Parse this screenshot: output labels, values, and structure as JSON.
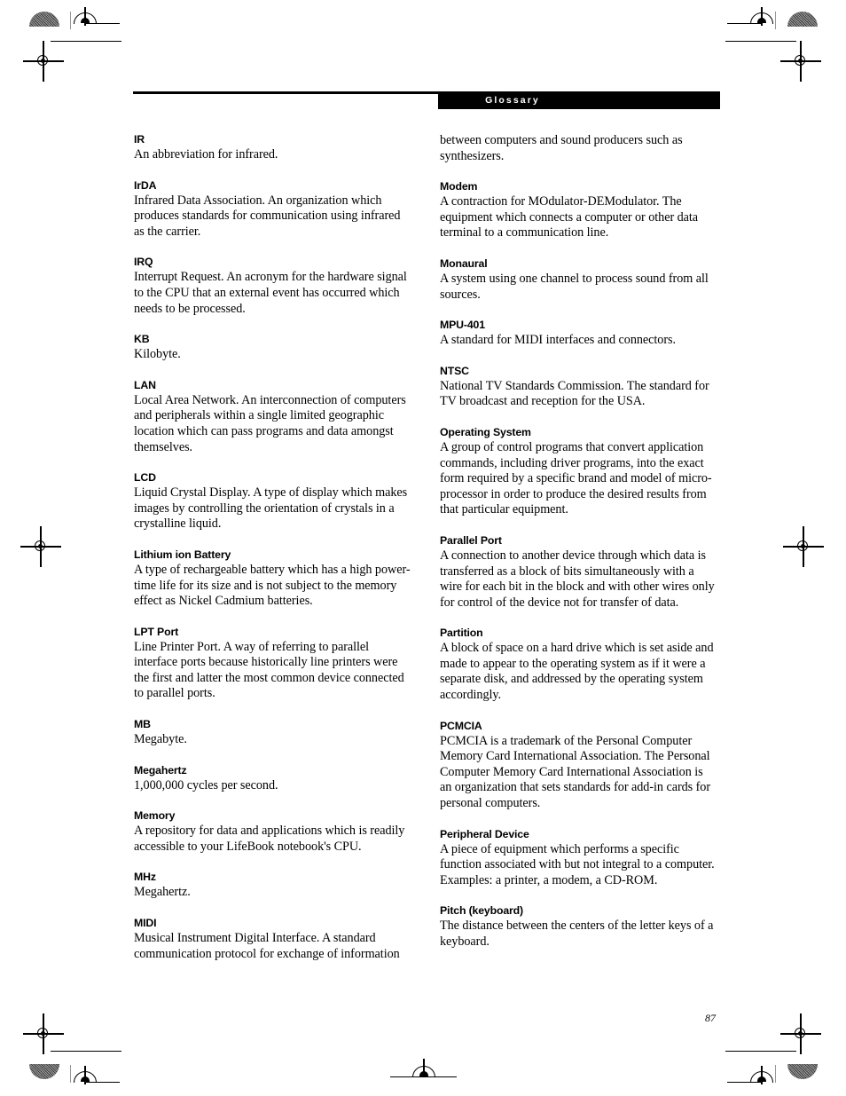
{
  "header": {
    "section_title": "Glossary"
  },
  "footer": {
    "page_number": "87"
  },
  "columns": {
    "left": [
      {
        "term": "IR",
        "definition": "An abbreviation for infrared."
      },
      {
        "term": "IrDA",
        "definition": "Infrared Data Association. An organization which produces standards for communication using infrared as the carrier."
      },
      {
        "term": "IRQ",
        "definition": "Interrupt Request. An acronym for the hardware signal to the CPU that an external event has occurred which needs to be processed."
      },
      {
        "term": "KB",
        "definition": "Kilobyte."
      },
      {
        "term": "LAN",
        "definition": "Local Area Network. An interconnection of computers and peripherals within a single limited geographic location which can pass programs and data amongst themselves."
      },
      {
        "term": "LCD",
        "definition": "Liquid Crystal Display. A type of display which makes images by controlling the orientation of crystals in a crystalline liquid."
      },
      {
        "term": "Lithium ion Battery",
        "definition": "A type of rechargeable battery which has a high power-time life for its size and is not subject to the memory effect as Nickel Cadmium batteries."
      },
      {
        "term": "LPT Port",
        "definition": "Line Printer Port. A way of referring to parallel interface ports because historically line printers were the first and latter the most common device connected to parallel ports."
      },
      {
        "term": "MB",
        "definition": "Megabyte."
      },
      {
        "term": "Megahertz",
        "definition": "1,000,000 cycles per second."
      },
      {
        "term": "Memory",
        "definition": "A repository for data and applications which is readily accessible to your LifeBook notebook's CPU."
      },
      {
        "term": "MHz",
        "definition": "Megahertz."
      },
      {
        "term": "MIDI",
        "definition": "Musical Instrument Digital Interface. A standard communication protocol for exchange of information"
      }
    ],
    "right": [
      {
        "term": "",
        "definition": "between computers and sound producers such as synthesizers."
      },
      {
        "term": "Modem",
        "definition": "A contraction for MOdulator-DEModulator. The equipment which connects a computer or other data terminal to a communication line."
      },
      {
        "term": "Monaural",
        "definition": "A system using one channel to process sound from all sources."
      },
      {
        "term": "MPU-401",
        "definition": "A standard for MIDI interfaces and connectors."
      },
      {
        "term": "NTSC",
        "definition": "National TV Standards Commission. The standard for TV broadcast and reception for the USA."
      },
      {
        "term": "Operating System",
        "definition": "A group of control programs that convert application commands, including driver programs, into the exact form required by a specific brand and model of micro-processor in order to produce the desired results from that particular equipment."
      },
      {
        "term": "Parallel Port",
        "definition": "A connection to another device through which data is transferred as a block of bits simultaneously with a wire for each bit in the block and with other wires only for control of the device not for transfer of data."
      },
      {
        "term": "Partition",
        "definition": "A block of space on a hard drive which is set aside and made to appear to the operating system as if it were a separate disk, and addressed by the operating system accordingly."
      },
      {
        "term": "PCMCIA",
        "definition": "PCMCIA is a trademark of the Personal Computer Memory Card International Association. The Personal Computer Memory Card International Association is an organization that sets standards for add-in cards for personal computers."
      },
      {
        "term": "Peripheral Device",
        "definition": "A piece of equipment which performs a specific function associated with but not integral to a computer. Examples: a printer, a modem, a CD-ROM."
      },
      {
        "term": "Pitch (keyboard)",
        "definition": "The distance between the centers of the letter keys of a keyboard."
      }
    ]
  }
}
